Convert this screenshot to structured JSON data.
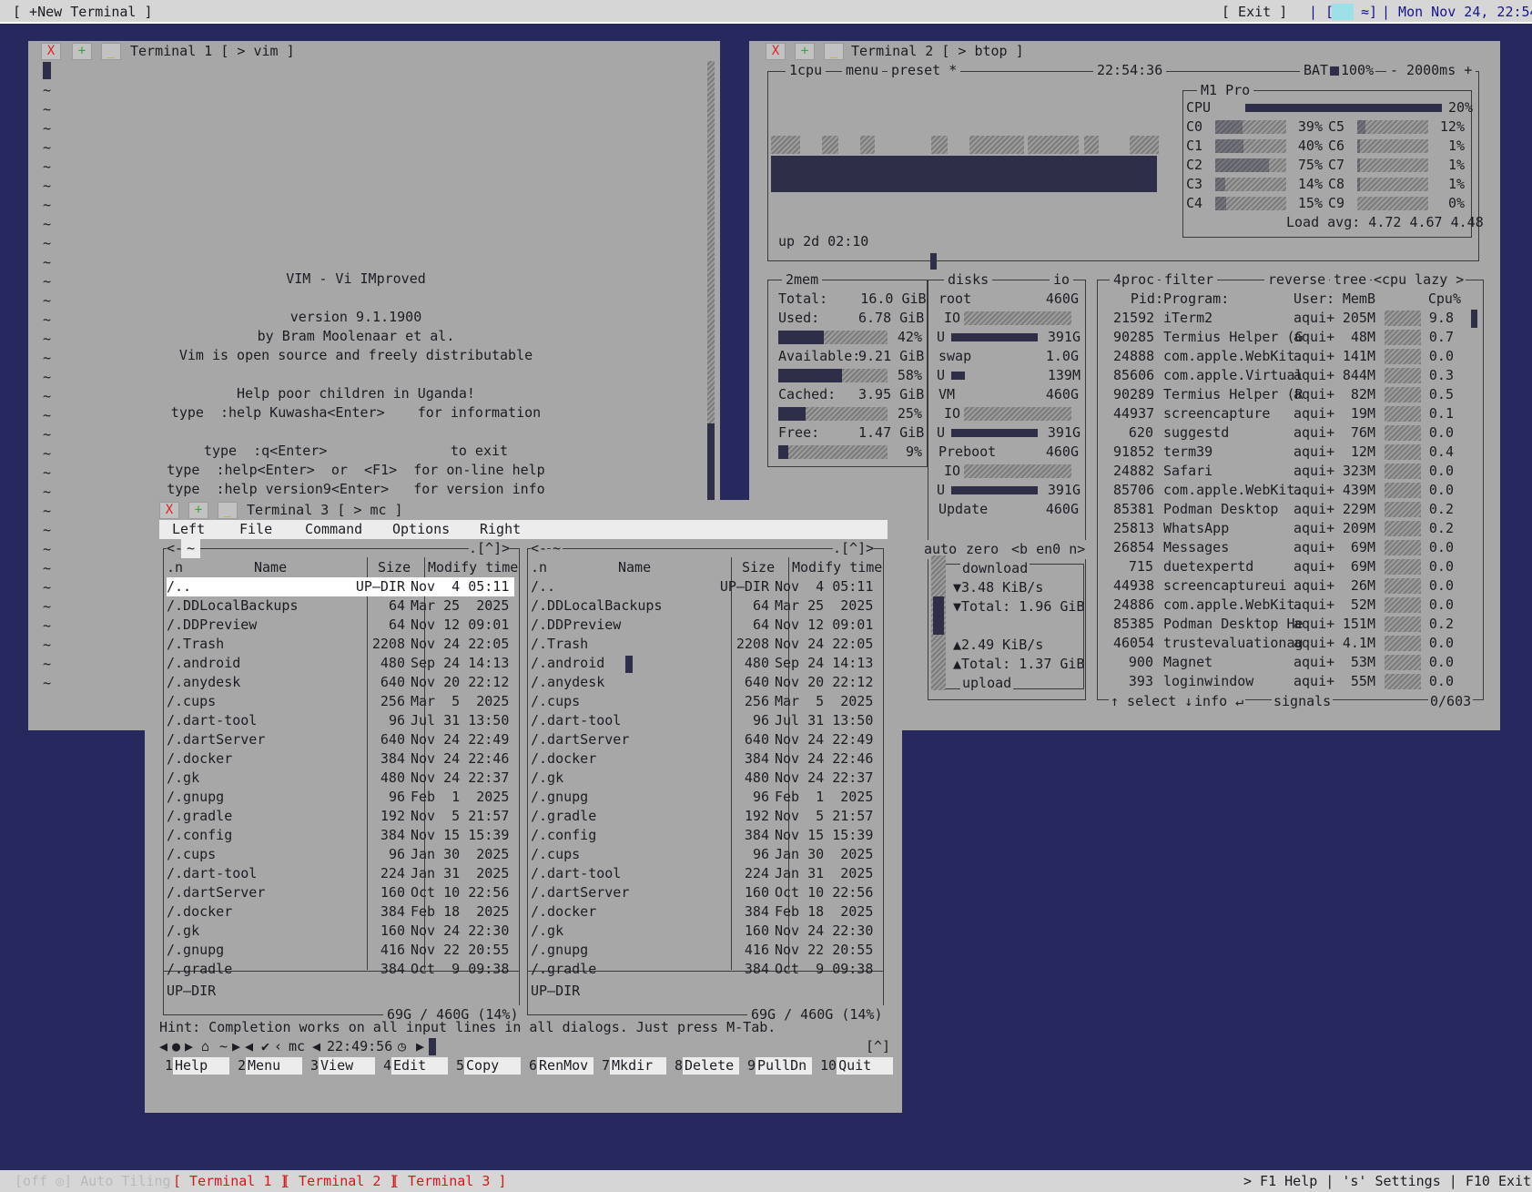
{
  "topbar": {
    "new_terminal": "[ +New Terminal ]",
    "exit": "[ Exit ]",
    "tray": "| [",
    "tray_icon": "≈]",
    "clock": "| Mon Nov 24, 22:54"
  },
  "statusbar": {
    "auto_tiling": "[off ◎] Auto Tiling",
    "tab1": "[ Terminal 1 ]",
    "tab2": "[ Terminal 2 ]",
    "tab3": "[ Terminal 3 ]",
    "help": "> F1 Help | 's' Settings | F10 Exit <"
  },
  "window_buttons": {
    "close": "X",
    "plus": "+",
    "min": "_"
  },
  "terminal1": {
    "title": "Terminal 1 [ > vim ]",
    "tilde": "~",
    "splash": [
      "VIM - Vi IMproved",
      "",
      "version 9.1.1900",
      "by Bram Moolenaar et al.",
      "Vim is open source and freely distributable",
      "",
      "Help poor children in Uganda!",
      "type  :help Kuwasha<Enter>    for information",
      "",
      "type  :q<Enter>               to exit",
      "type  :help<Enter>  or  <F1>  for on-line help",
      "type  :help version9<Enter>   for version info"
    ]
  },
  "terminal2": {
    "title": "Terminal 2 [ > btop ]",
    "header": {
      "cpu": "1cpu",
      "menu": "menu",
      "preset": "preset *",
      "time": "22:54:36",
      "bat": "BAT",
      "bat_pct": "100%",
      "interval": "- 2000ms +"
    },
    "cpu_box": {
      "model": "M1 Pro",
      "total_label": "CPU",
      "total_pct": "20%",
      "cores_left": [
        {
          "name": "C0",
          "pct": "39%",
          "level": 0.39
        },
        {
          "name": "C1",
          "pct": "40%",
          "level": 0.4
        },
        {
          "name": "C2",
          "pct": "75%",
          "level": 0.75
        },
        {
          "name": "C3",
          "pct": "14%",
          "level": 0.14
        },
        {
          "name": "C4",
          "pct": "15%",
          "level": 0.15
        }
      ],
      "cores_right": [
        {
          "name": "C5",
          "pct": "12%",
          "level": 0.12
        },
        {
          "name": "C6",
          "pct": "1%",
          "level": 0.01
        },
        {
          "name": "C7",
          "pct": "1%",
          "level": 0.01
        },
        {
          "name": "C8",
          "pct": "1%",
          "level": 0.01
        },
        {
          "name": "C9",
          "pct": "0%",
          "level": 0.0
        }
      ],
      "load": "Load avg: 4.72 4.67 4.48"
    },
    "uptime": "up 2d 02:10",
    "mem": {
      "label": "2mem",
      "total": "Total:    16.0 GiB",
      "used": "Used:",
      "used_val": "6.78 GiB",
      "used_pct": "42%",
      "available": "Available:",
      "available_val": "9.21 GiB",
      "available_pct": "58%",
      "cached": "Cached:",
      "cached_val": "3.95 GiB",
      "cached_pct": "25%",
      "free": "Free:",
      "free_val": "1.47 GiB",
      "free_pct": "9%"
    },
    "disks": {
      "label": "disks",
      "io": "io",
      "items": [
        {
          "name": "root",
          "size": "460G",
          "io": "IO",
          "u": "U",
          "used": "391G"
        },
        {
          "name": "swap",
          "size": "1.0G",
          "io": "",
          "u": "U",
          "used": "139M"
        },
        {
          "name": "VM",
          "size": "460G",
          "io": "IO",
          "u": "U",
          "used": "391G"
        },
        {
          "name": "Preboot",
          "size": "460G",
          "io": "IO",
          "u": "U",
          "used": "391G"
        },
        {
          "name": "Update",
          "size": "460G",
          "io": "",
          "u": "",
          "used": ""
        }
      ]
    },
    "net": {
      "auto": "auto",
      "zero": "zero",
      "iface": "<b en0 n>",
      "download": "download",
      "down_rate": "▼3.48 KiB/s",
      "down_total": "▼Total: 1.96 GiB",
      "up_rate": "▲2.49 KiB/s",
      "up_total": "▲Total: 1.37 GiB",
      "upload": "upload"
    },
    "proc": {
      "label": "4proc",
      "filter": "filter",
      "reverse": "reverse",
      "tree": "tree",
      "sort": "<cpu lazy >",
      "headers": {
        "pid": "Pid:",
        "program": "Program:",
        "user": "User:",
        "mem": "MemB",
        "cpu": "Cpu%"
      },
      "rows": [
        {
          "pid": "21592",
          "program": "iTerm2",
          "user": "aqui+",
          "mem": "205M",
          "cpu": "9.8"
        },
        {
          "pid": "90285",
          "program": "Termius Helper (G",
          "user": "aqui+",
          "mem": "48M",
          "cpu": "0.7"
        },
        {
          "pid": "24888",
          "program": "com.apple.WebKit.",
          "user": "aqui+",
          "mem": "141M",
          "cpu": "0.0"
        },
        {
          "pid": "85606",
          "program": "com.apple.Virtual",
          "user": "aqui+",
          "mem": "844M",
          "cpu": "0.3"
        },
        {
          "pid": "90289",
          "program": "Termius Helper (R",
          "user": "aqui+",
          "mem": "82M",
          "cpu": "0.5"
        },
        {
          "pid": "44937",
          "program": "screencapture",
          "user": "aqui+",
          "mem": "19M",
          "cpu": "0.1"
        },
        {
          "pid": "620",
          "program": "suggestd",
          "user": "aqui+",
          "mem": "76M",
          "cpu": "0.0"
        },
        {
          "pid": "91852",
          "program": "term39",
          "user": "aqui+",
          "mem": "12M",
          "cpu": "0.4"
        },
        {
          "pid": "24882",
          "program": "Safari",
          "user": "aqui+",
          "mem": "323M",
          "cpu": "0.0"
        },
        {
          "pid": "85706",
          "program": "com.apple.WebKit.",
          "user": "aqui+",
          "mem": "439M",
          "cpu": "0.0"
        },
        {
          "pid": "85381",
          "program": "Podman Desktop",
          "user": "aqui+",
          "mem": "229M",
          "cpu": "0.2"
        },
        {
          "pid": "25813",
          "program": "WhatsApp",
          "user": "aqui+",
          "mem": "209M",
          "cpu": "0.2"
        },
        {
          "pid": "26854",
          "program": "Messages",
          "user": "aqui+",
          "mem": "69M",
          "cpu": "0.0"
        },
        {
          "pid": "715",
          "program": "duetexpertd",
          "user": "aqui+",
          "mem": "69M",
          "cpu": "0.0"
        },
        {
          "pid": "44938",
          "program": "screencaptureui",
          "user": "aqui+",
          "mem": "26M",
          "cpu": "0.0"
        },
        {
          "pid": "24886",
          "program": "com.apple.WebKit.",
          "user": "aqui+",
          "mem": "52M",
          "cpu": "0.0"
        },
        {
          "pid": "85385",
          "program": "Podman Desktop He",
          "user": "aqui+",
          "mem": "151M",
          "cpu": "0.2"
        },
        {
          "pid": "46054",
          "program": "trustevaluationag",
          "user": "aqui+",
          "mem": "4.1M",
          "cpu": "0.0"
        },
        {
          "pid": "900",
          "program": "Magnet",
          "user": "aqui+",
          "mem": "53M",
          "cpu": "0.0"
        },
        {
          "pid": "393",
          "program": "loginwindow",
          "user": "aqui+",
          "mem": "55M",
          "cpu": "0.0"
        }
      ],
      "footer_select": "↑ select ↓",
      "footer_info": "info ↵",
      "footer_signals": "signals",
      "count": "0/603"
    }
  },
  "terminal3": {
    "title": "Terminal 3 [ > mc ]",
    "menu": [
      "Left",
      "File",
      "Command",
      "Options",
      "Right"
    ],
    "panel_path": "~",
    "panel_corner": ".[^]>",
    "panel_left_arrow": "<-",
    "headers": {
      "n": ".n",
      "name": "Name",
      "size": "Size",
      "modify": "Modify time"
    },
    "left_rows": [
      {
        "name": "/..",
        "size": "UP—DIR",
        "time": "Nov  4 05:11"
      },
      {
        "name": "/.DDLocalBackups",
        "size": "64",
        "time": "Mar 25  2025"
      },
      {
        "name": "/.DDPreview",
        "size": "64",
        "time": "Nov 12 09:01"
      },
      {
        "name": "/.Trash",
        "size": "2208",
        "time": "Nov 24 22:05"
      },
      {
        "name": "/.android",
        "size": "480",
        "time": "Sep 24 14:13"
      },
      {
        "name": "/.anydesk",
        "size": "640",
        "time": "Nov 20 22:12"
      },
      {
        "name": "/.cups",
        "size": "256",
        "time": "Mar  5  2025"
      },
      {
        "name": "/.dart-tool",
        "size": "96",
        "time": "Jul 31 13:50"
      },
      {
        "name": "/.dartServer",
        "size": "640",
        "time": "Nov 24 22:49"
      },
      {
        "name": "/.docker",
        "size": "384",
        "time": "Nov 24 22:46"
      },
      {
        "name": "/.gk",
        "size": "480",
        "time": "Nov 24 22:37"
      },
      {
        "name": "/.gnupg",
        "size": "96",
        "time": "Feb  1  2025"
      },
      {
        "name": "/.gradle",
        "size": "192",
        "time": "Nov  5 21:57"
      },
      {
        "name": "/.config",
        "size": "384",
        "time": "Nov 15 15:39"
      },
      {
        "name": "/.cups",
        "size": "96",
        "time": "Jan 30  2025"
      },
      {
        "name": "/.dart-tool",
        "size": "224",
        "time": "Jan 31  2025"
      },
      {
        "name": "/.dartServer",
        "size": "160",
        "time": "Oct 10 22:56"
      },
      {
        "name": "/.docker",
        "size": "384",
        "time": "Feb 18  2025"
      },
      {
        "name": "/.gk",
        "size": "160",
        "time": "Nov 24 22:30"
      },
      {
        "name": "/.gnupg",
        "size": "416",
        "time": "Nov 22 20:55"
      },
      {
        "name": "/.gradle",
        "size": "384",
        "time": "Oct  9 09:38"
      }
    ],
    "status_left": "UP—DIR",
    "status_right": "UP—DIR",
    "disk_left": "69G / 460G (14%)",
    "disk_right": "69G / 460G (14%)",
    "hint": "Hint: Completion works on all input lines in all dialogs. Just press M-Tab.",
    "prompt": {
      "app": "mc",
      "clock": "22:49:56",
      "caret": "[^]"
    },
    "fkeys": [
      {
        "n": "1",
        "label": "Help"
      },
      {
        "n": "2",
        "label": "Menu"
      },
      {
        "n": "3",
        "label": "View"
      },
      {
        "n": "4",
        "label": "Edit"
      },
      {
        "n": "5",
        "label": "Copy"
      },
      {
        "n": "6",
        "label": "RenMov"
      },
      {
        "n": "7",
        "label": "Mkdir"
      },
      {
        "n": "8",
        "label": "Delete"
      },
      {
        "n": "9",
        "label": "PullDn"
      },
      {
        "n": "10",
        "label": "Quit"
      }
    ]
  }
}
